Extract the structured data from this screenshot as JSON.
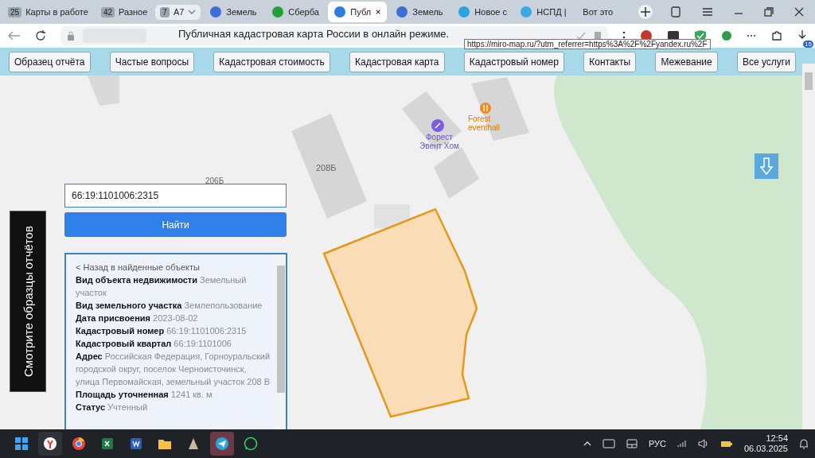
{
  "browser": {
    "tab_groups": [
      {
        "count": "25",
        "label": "Карты в работе",
        "selected": false
      },
      {
        "count": "42",
        "label": "Разное",
        "selected": false
      },
      {
        "count": "7",
        "label": "А7",
        "selected": true
      }
    ],
    "tabs": [
      {
        "label": "Земель",
        "selected": false,
        "color": "#3b6fd1"
      },
      {
        "label": "Сберба",
        "selected": false,
        "color": "#21a038"
      },
      {
        "label": "Публ",
        "selected": true,
        "color": "#2a7de1"
      },
      {
        "label": "Земель",
        "selected": false,
        "color": "#3b6fd1"
      },
      {
        "label": "Новое с",
        "selected": false,
        "color": "#2fa0e0"
      },
      {
        "label": "НСПД |",
        "selected": false,
        "color": "#3aa7e6"
      },
      {
        "label": "Вот это",
        "selected": false
      }
    ],
    "page_title": "Публичная кадастровая карта России в онлайн режиме.",
    "link_tooltip": "https://miro-map.ru/?utm_referrer=https%3A%2F%2Fyandex.ru%2F",
    "downloads_badge": "15"
  },
  "site_nav": [
    "Образец отчёта",
    "Частые вопросы",
    "Кадастровая стоимость",
    "Кадастровая карта",
    "Кадастровый номер",
    "Контакты",
    "Межевание",
    "Все услуги"
  ],
  "map": {
    "labels": [
      {
        "kind": "building",
        "text": "206Б"
      },
      {
        "kind": "building",
        "text": "208Б"
      },
      {
        "kind": "poi",
        "text": "Форест\nЭвент Хом"
      },
      {
        "kind": "cafe",
        "text": "Forest\neventhall"
      }
    ],
    "search": {
      "value": "66:19:1101006:2315",
      "button": "Найти"
    },
    "info": {
      "back_link": "< Назад в найденные объекты",
      "fields": [
        {
          "label": "Вид объекта недвижимости",
          "value": "Земельный участок"
        },
        {
          "label": "Вид земельного участка",
          "value": "Землепользование"
        },
        {
          "label": "Дата присвоения",
          "value": "2023-08-02"
        },
        {
          "label": "Кадастровый номер",
          "value": "66:19:1101006:2315"
        },
        {
          "label": "Кадастровый квартал",
          "value": "66:19:1101006"
        },
        {
          "label": "Адрес",
          "value": "Российская Федерация, Горноуральский городской округ, поселок Черноисточинск, улица Первомайская, земельный участок 208 В"
        },
        {
          "label": "Площадь уточненная",
          "value": "1241 кв. м"
        },
        {
          "label": "Статус",
          "value": "Учтенный"
        }
      ]
    },
    "side_button": "Смотрите образцы отчётов"
  },
  "taskbar": {
    "language": "РУС",
    "time": "12:54",
    "date": "06.03.2025"
  }
}
